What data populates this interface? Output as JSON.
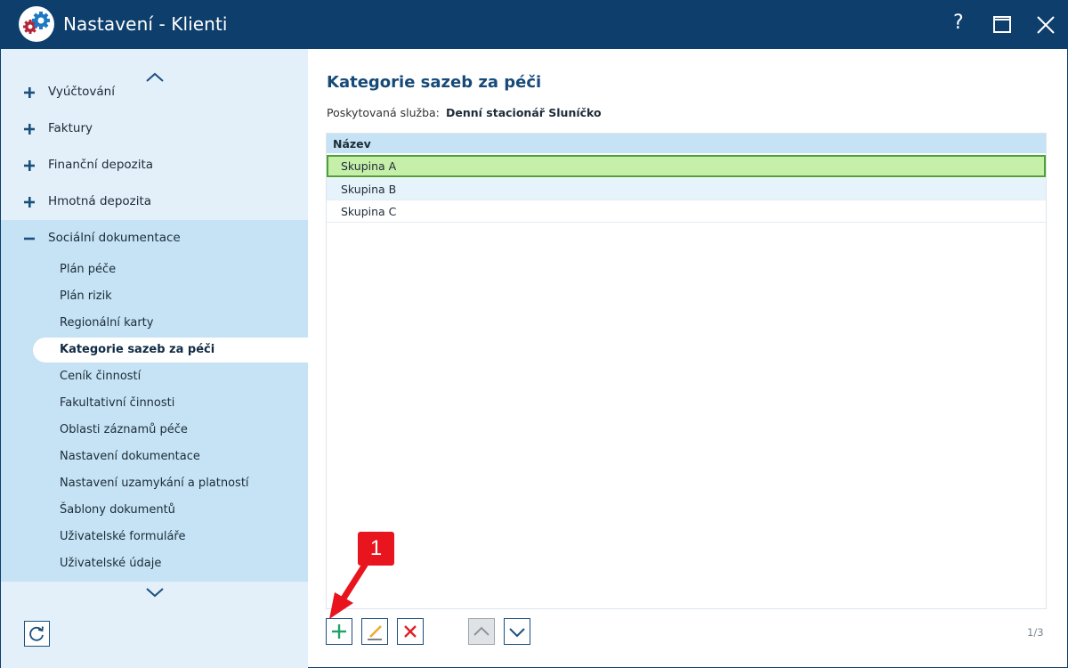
{
  "window": {
    "title": "Nastavení - Klienti",
    "help_label": "?"
  },
  "sidebar": {
    "top_items": [
      {
        "label": "Vyúčtování",
        "state": "collapsed"
      },
      {
        "label": "Faktury",
        "state": "collapsed"
      },
      {
        "label": "Finanční depozita",
        "state": "collapsed"
      },
      {
        "label": "Hmotná depozita",
        "state": "collapsed"
      },
      {
        "label": "Sociální dokumentace",
        "state": "expanded"
      }
    ],
    "sub_items": [
      {
        "label": "Plán péče"
      },
      {
        "label": "Plán rizik"
      },
      {
        "label": "Regionální karty"
      },
      {
        "label": "Kategorie sazeb za péči",
        "active": true
      },
      {
        "label": "Ceník činností"
      },
      {
        "label": "Fakultativní činnosti"
      },
      {
        "label": "Oblasti záznamů péče"
      },
      {
        "label": "Nastavení dokumentace"
      },
      {
        "label": "Nastavení uzamykání a platností"
      },
      {
        "label": "Šablony dokumentů"
      },
      {
        "label": "Uživatelské formuláře"
      },
      {
        "label": "Uživatelské údaje"
      }
    ]
  },
  "main": {
    "heading": "Kategorie sazeb za péči",
    "service_label": "Poskytovaná služba:",
    "service_value": "Denní stacionář Sluníčko",
    "table": {
      "column_header": "Název",
      "rows": [
        {
          "name": "Skupina A",
          "selected": true
        },
        {
          "name": "Skupina B"
        },
        {
          "name": "Skupina C"
        }
      ]
    },
    "actions": {
      "add": "plus-icon",
      "edit": "pencil-icon",
      "delete": "x-icon",
      "move_up": "chevron-up-icon",
      "move_down": "chevron-down-icon"
    },
    "pager": "1/3"
  },
  "annotation": {
    "callout_number": "1"
  },
  "colors": {
    "titlebar": "#0d3e6c",
    "sidebar_bg": "#e3f0fa",
    "sidebar_section_bg": "#c5e3f4",
    "selected_row": "#c6efaa",
    "selected_border": "#4f9f3a",
    "callout": "#e8141e"
  }
}
